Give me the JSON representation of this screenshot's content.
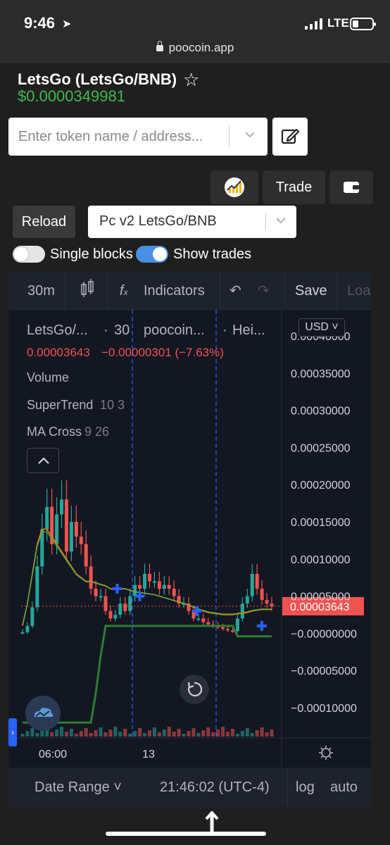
{
  "status_bar": {
    "time": "9:46",
    "network": "LTE",
    "url": "poocoin.app"
  },
  "token": {
    "title": "LetsGo (LetsGo/BNB)",
    "price": "$0.0000349981"
  },
  "search": {
    "placeholder": "Enter token name / address..."
  },
  "actions": {
    "trade_label": "Trade",
    "reload_label": "Reload",
    "pair_selected": "Pc v2 LetsGo/BNB"
  },
  "toggles": {
    "single_blocks_label": "Single blocks",
    "single_blocks_on": false,
    "show_trades_label": "Show trades",
    "show_trades_on": true
  },
  "toolbar": {
    "interval": "30m",
    "indicators_label": "Indicators",
    "save_label": "Save",
    "load_label": "Loa"
  },
  "legend": {
    "symbol": "LetsGo/...",
    "dot1": "·",
    "interval": "30",
    "exchange": "poocoin...",
    "dot2": "·",
    "chart_style": "Hei...",
    "last_value": "0.00003643",
    "change": "−0.00000301 (−7.63%)",
    "indicator_volume": "Volume",
    "indicator_supertrend": "SuperTrend",
    "supertrend_params": "10 3",
    "indicator_macross": "MA Cross",
    "macross_params": "9 26"
  },
  "currency_label": "USD",
  "axis": {
    "y_ticks": [
      "0.00040000",
      "0.00035000",
      "0.00030000",
      "0.00025000",
      "0.00020000",
      "0.00015000",
      "0.00010000",
      "0.00005000",
      "−0.00000000",
      "−0.00005000",
      "−0.00010000"
    ],
    "x_ticks": [
      "06:00",
      "13"
    ],
    "price_tag": "0.00003643"
  },
  "bottom_bar": {
    "date_range": "Date Range",
    "clock": "21:46:02 (UTC-4)",
    "log": "log",
    "auto": "auto"
  },
  "colors": {
    "up": "#26a69a",
    "down": "#ef5350",
    "supertrend": "#2e7d32",
    "ma_fast": "#f57c00",
    "ma_slow": "#4caf50",
    "trade_marker": "#2962ff"
  },
  "chart_data": {
    "type": "line",
    "title": "",
    "xlabel": "",
    "ylabel": "",
    "ylim": [
      -0.00013,
      0.00041
    ],
    "x_ticks": [
      "06:00",
      "13"
    ],
    "series": [
      {
        "values": [
          1.5e-06,
          1e-05,
          3.5e-05,
          9e-05,
          0.00014,
          0.00017,
          0.00012,
          0.00016,
          0.00018,
          0.00011,
          0.00015,
          0.00013,
          0.00012,
          9e-05,
          6e-05,
          5e-05,
          5e-05,
          3e-05,
          2e-05,
          2.5e-05,
          4e-05,
          3e-05,
          5e-05,
          6.5e-05,
          6e-05,
          8e-05,
          7e-05,
          7e-05,
          6e-05,
          6.5e-05,
          6e-05,
          5e-05,
          4e-05,
          4e-05,
          3e-05,
          2e-05,
          2e-05,
          1.5e-05,
          1.2e-05,
          1e-05,
          8e-06,
          6e-06,
          4e-06,
          3e-06,
          2e-05,
          4e-05,
          5e-05,
          8e-05,
          6e-05,
          4.5e-05,
          4e-05,
          3.6e-05
        ]
      },
      {
        "values": [
          -0.00012,
          -0.00012,
          -0.00012,
          -0.00012,
          -0.00012,
          -0.00012,
          -0.00012,
          -0.00012,
          -0.00012,
          -0.00012,
          -0.00012,
          -0.00012,
          -0.00012,
          -0.00012,
          -0.00012,
          -8e-05,
          -3e-05,
          1e-05,
          1e-05,
          1e-05,
          1e-05,
          1e-05,
          1e-05,
          1e-05,
          1e-05,
          1e-05,
          1e-05,
          1e-05,
          1e-05,
          1e-05,
          1e-05,
          1e-05,
          1e-05,
          1e-05,
          1e-05,
          1e-05,
          1e-05,
          1e-05,
          1e-05,
          1e-05,
          1e-05,
          1e-05,
          1e-05,
          1e-05,
          -4e-06,
          -4e-06,
          -4e-06,
          -4e-06,
          -4e-06,
          -4e-06,
          -4e-06,
          -4e-06
        ]
      },
      {
        "values": [
          1e-05,
          4e-05,
          8e-05,
          0.00012,
          0.00014,
          0.00014,
          0.00013,
          0.00012,
          0.00011,
          0.0001,
          9e-05,
          8e-05,
          7.5e-05,
          7e-05,
          7e-05,
          6.8e-05,
          6.6e-05,
          6.4e-05,
          6e-05,
          6e-05,
          6e-05,
          6e-05,
          5.8e-05,
          5.6e-05,
          5.5e-05,
          5.4e-05,
          5.3e-05,
          5.2e-05,
          5e-05,
          4.8e-05,
          4.6e-05,
          4.4e-05,
          4.2e-05,
          4e-05,
          3.8e-05,
          3.5e-05,
          3.2e-05,
          3e-05,
          2.8e-05,
          2.7e-05,
          2.6e-05,
          2.5e-05,
          2.5e-05,
          2.5e-05,
          2.6e-05,
          2.7e-05,
          2.8e-05,
          3e-05,
          3.1e-05,
          3.2e-05,
          3.2e-05,
          3.2e-05
        ]
      }
    ]
  }
}
